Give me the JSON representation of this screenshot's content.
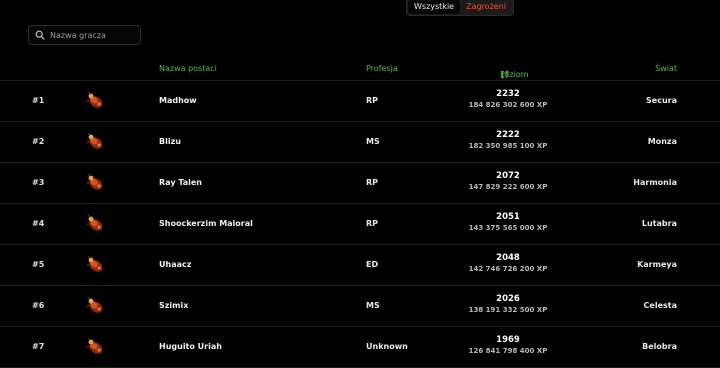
{
  "filters": {
    "all_label": "Wszystkie",
    "threat_label": "Zagrożeni"
  },
  "search": {
    "placeholder": "Nazwa gracza",
    "value": ""
  },
  "table": {
    "headers": {
      "name": "Nazwa postaci",
      "profession": "Profesja",
      "level": "Poziom",
      "world": "Świat"
    },
    "rows": [
      {
        "rank": "#1",
        "name": "Madhow",
        "profession": "RP",
        "level": "2232",
        "xp": "184 826 302 600 XP",
        "world": "Secura"
      },
      {
        "rank": "#2",
        "name": "Blizu",
        "profession": "MS",
        "level": "2222",
        "xp": "182 350 985 100 XP",
        "world": "Monza"
      },
      {
        "rank": "#3",
        "name": "Ray Talen",
        "profession": "RP",
        "level": "2072",
        "xp": "147 829 222 600 XP",
        "world": "Harmonia"
      },
      {
        "rank": "#4",
        "name": "Shoockerzim Maioral",
        "profession": "RP",
        "level": "2051",
        "xp": "143 375 565 000 XP",
        "world": "Lutabra"
      },
      {
        "rank": "#5",
        "name": "Uhaacz",
        "profession": "ED",
        "level": "2048",
        "xp": "142 746 726 200 XP",
        "world": "Karmeya"
      },
      {
        "rank": "#6",
        "name": "Szimix",
        "profession": "MS",
        "level": "2026",
        "xp": "138 191 332 500 XP",
        "world": "Celesta"
      },
      {
        "rank": "#7",
        "name": "Huguito Uriah",
        "profession": "Unknown",
        "level": "1969",
        "xp": "126 841 798 400 XP",
        "world": "Belobra"
      }
    ]
  },
  "colors": {
    "accent_green": "#5ab55a",
    "threat_red": "#e5533b",
    "background": "#000000"
  },
  "icons": {
    "search": "search-icon",
    "sort": "sort-descending-icon",
    "avatar": "character-outfit-icon"
  }
}
